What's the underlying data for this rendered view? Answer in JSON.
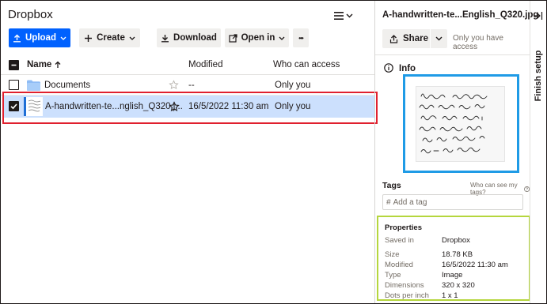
{
  "app": {
    "title": "Dropbox"
  },
  "toolbar": {
    "upload_label": "Upload",
    "create_label": "Create",
    "download_label": "Download",
    "open_in_label": "Open in",
    "more_label": "•••"
  },
  "list": {
    "columns": {
      "name": "Name",
      "modified": "Modified",
      "access": "Who can access"
    },
    "rows": [
      {
        "name": "Documents",
        "modified": "--",
        "access": "Only you"
      },
      {
        "name": "A-handwritten-te...nglish_Q320.j...",
        "modified": "16/5/2022 11:30 am",
        "access": "Only you"
      }
    ]
  },
  "details": {
    "file_title": "A-handwritten-te...English_Q320.jpg",
    "share_label": "Share",
    "access_text": "Only you have access",
    "info_label": "Info",
    "tags_label": "Tags",
    "tags_help": "Who can see my tags?",
    "tag_input_placeholder": "Add a tag",
    "properties_label": "Properties",
    "properties": [
      {
        "label": "Saved in",
        "value": "Dropbox"
      },
      {
        "label": "Size",
        "value": "18.78 KB"
      },
      {
        "label": "Modified",
        "value": "16/5/2022 11:30 am"
      },
      {
        "label": "Type",
        "value": "Image"
      },
      {
        "label": "Dimensions",
        "value": "320 x 320"
      },
      {
        "label": "Dots per inch",
        "value": "1 x 1"
      }
    ]
  },
  "rail": {
    "label": "Finish setup"
  },
  "colors": {
    "accent": "#0061fe",
    "selected_row": "#cce0fd",
    "highlight_red": "#e0202e",
    "highlight_blue": "#1f9be6",
    "highlight_green": "#b5d63d"
  },
  "icons": [
    "list-view-icon",
    "chevron-down-icon",
    "upload-icon",
    "plus-icon",
    "download-icon",
    "open-in-icon",
    "sort-arrow-up-icon",
    "folder-icon",
    "star-icon",
    "image-thumbnail-icon",
    "collapse-panel-icon",
    "info-icon",
    "help-icon",
    "hash-icon"
  ]
}
